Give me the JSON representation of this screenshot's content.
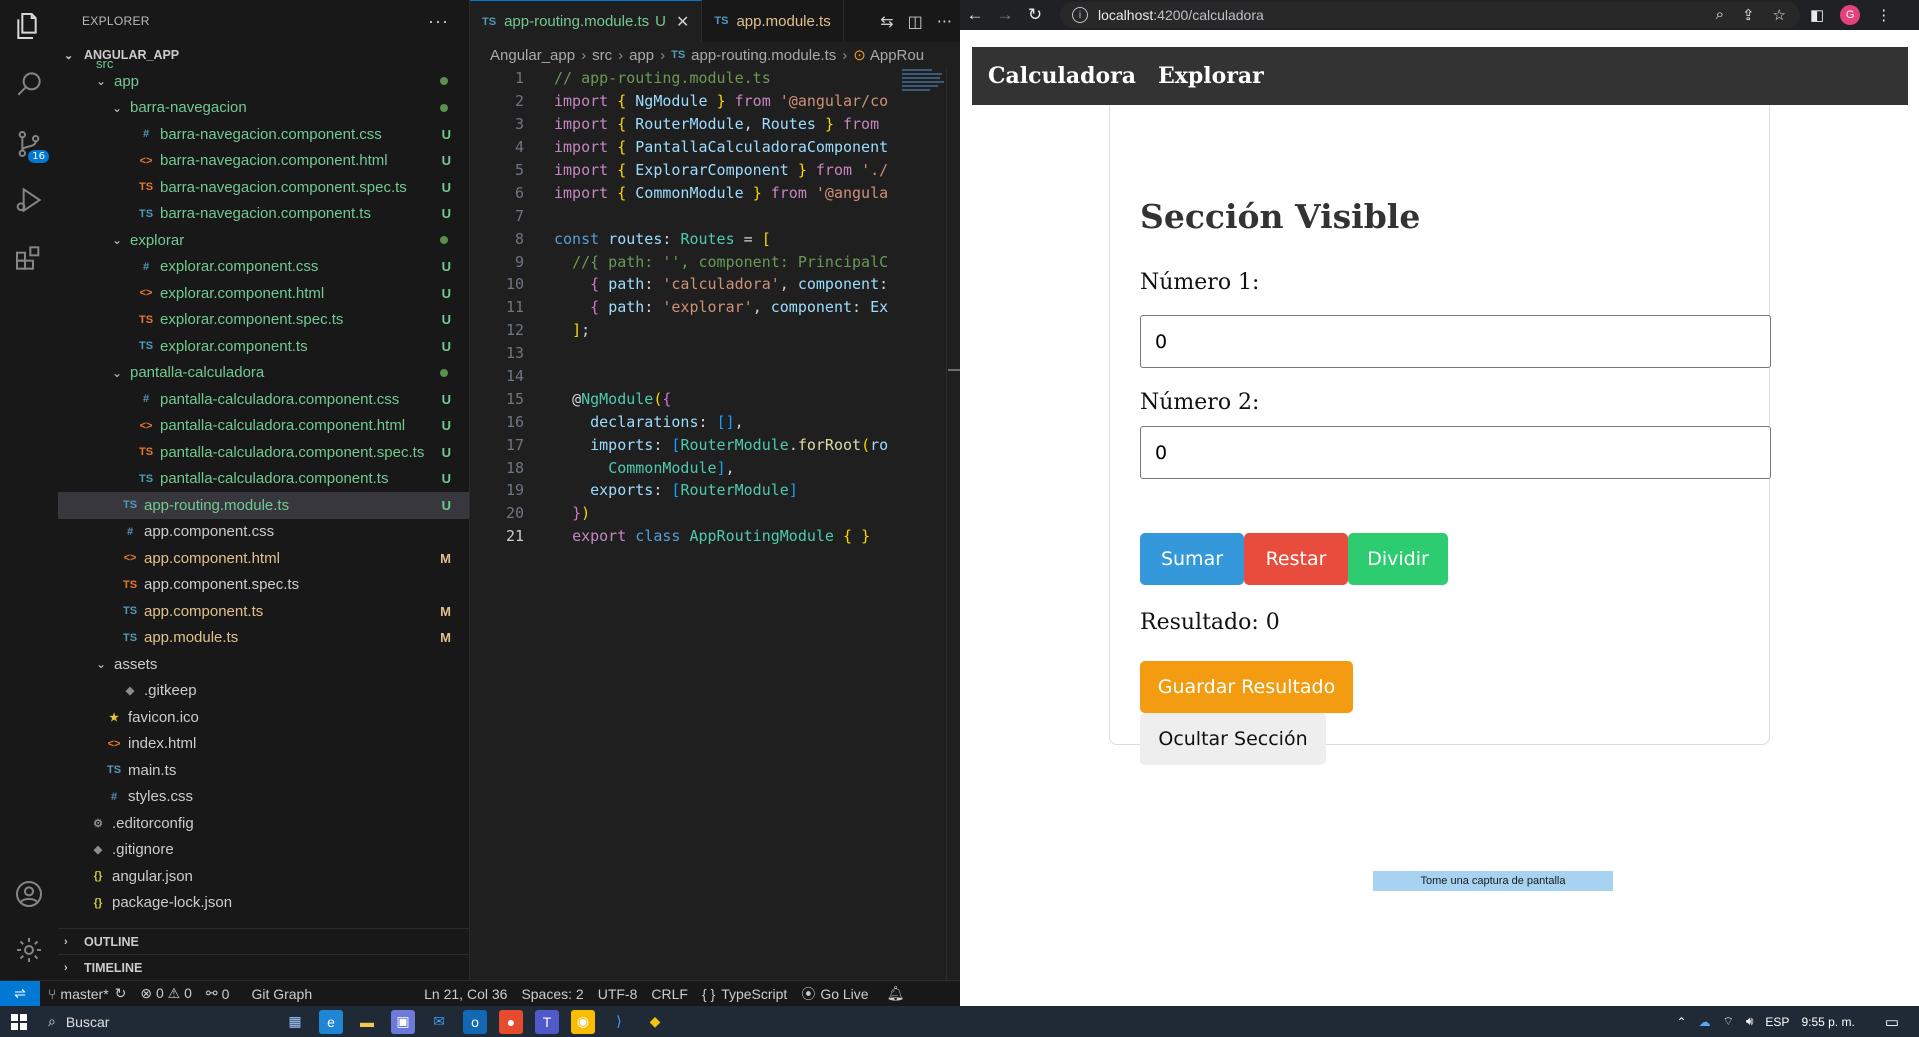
{
  "vscode": {
    "activity_bar": {
      "items": [
        {
          "name": "explorer-icon",
          "active": true
        },
        {
          "name": "search-icon"
        },
        {
          "name": "source-control-icon",
          "badge": "16"
        },
        {
          "name": "run-debug-icon"
        },
        {
          "name": "extensions-icon"
        }
      ],
      "bottom": [
        {
          "name": "accounts-icon"
        },
        {
          "name": "manage-gear-icon"
        }
      ]
    },
    "explorer": {
      "header": "EXPLORER",
      "more_actions": "···",
      "root_label": "ANGULAR_APP",
      "src_label": "src",
      "tree": [
        {
          "label": "app",
          "type": "folder",
          "depth": 1,
          "status": "dot",
          "color": "green"
        },
        {
          "label": "barra-navegacion",
          "type": "folder",
          "depth": 2,
          "status": "dot",
          "color": "green"
        },
        {
          "label": "barra-navegacion.component.css",
          "type": "css",
          "depth": 3,
          "status": "U",
          "color": "green"
        },
        {
          "label": "barra-navegacion.component.html",
          "type": "html",
          "depth": 3,
          "status": "U",
          "color": "green"
        },
        {
          "label": "barra-navegacion.component.spec.ts",
          "type": "spec",
          "depth": 3,
          "status": "U",
          "color": "green"
        },
        {
          "label": "barra-navegacion.component.ts",
          "type": "ts",
          "depth": 3,
          "status": "U",
          "color": "green"
        },
        {
          "label": "explorar",
          "type": "folder",
          "depth": 2,
          "status": "dot",
          "color": "green"
        },
        {
          "label": "explorar.component.css",
          "type": "css",
          "depth": 3,
          "status": "U",
          "color": "green"
        },
        {
          "label": "explorar.component.html",
          "type": "html",
          "depth": 3,
          "status": "U",
          "color": "green"
        },
        {
          "label": "explorar.component.spec.ts",
          "type": "spec",
          "depth": 3,
          "status": "U",
          "color": "green"
        },
        {
          "label": "explorar.component.ts",
          "type": "ts",
          "depth": 3,
          "status": "U",
          "color": "green"
        },
        {
          "label": "pantalla-calculadora",
          "type": "folder",
          "depth": 2,
          "status": "dot",
          "color": "green"
        },
        {
          "label": "pantalla-calculadora.component.css",
          "type": "css",
          "depth": 3,
          "status": "U",
          "color": "green"
        },
        {
          "label": "pantalla-calculadora.component.html",
          "type": "html",
          "depth": 3,
          "status": "U",
          "color": "green"
        },
        {
          "label": "pantalla-calculadora.component.spec.ts",
          "type": "spec",
          "depth": 3,
          "status": "U",
          "color": "green"
        },
        {
          "label": "pantalla-calculadora.component.ts",
          "type": "ts",
          "depth": 3,
          "status": "U",
          "color": "green"
        },
        {
          "label": "app-routing.module.ts",
          "type": "ts",
          "depth": 2,
          "status": "U",
          "color": "green",
          "selected": true
        },
        {
          "label": "app.component.css",
          "type": "css",
          "depth": 2,
          "status": "",
          "color": "white"
        },
        {
          "label": "app.component.html",
          "type": "html",
          "depth": 2,
          "status": "M",
          "color": "mod"
        },
        {
          "label": "app.component.spec.ts",
          "type": "spec",
          "depth": 2,
          "status": "",
          "color": "white"
        },
        {
          "label": "app.component.ts",
          "type": "ts",
          "depth": 2,
          "status": "M",
          "color": "mod"
        },
        {
          "label": "app.module.ts",
          "type": "ts",
          "depth": 2,
          "status": "M",
          "color": "mod"
        },
        {
          "label": "assets",
          "type": "folder",
          "depth": 1,
          "status": "",
          "color": "white"
        },
        {
          "label": ".gitkeep",
          "type": "git",
          "depth": 2,
          "status": "",
          "color": "white"
        },
        {
          "label": "favicon.ico",
          "type": "star",
          "depth": 1,
          "status": "",
          "color": "white"
        },
        {
          "label": "index.html",
          "type": "html",
          "depth": 1,
          "status": "",
          "color": "white"
        },
        {
          "label": "main.ts",
          "type": "ts",
          "depth": 1,
          "status": "",
          "color": "white"
        },
        {
          "label": "styles.css",
          "type": "css",
          "depth": 1,
          "status": "",
          "color": "white"
        },
        {
          "label": ".editorconfig",
          "type": "gear",
          "depth": 0,
          "status": "",
          "color": "white"
        },
        {
          "label": ".gitignore",
          "type": "git",
          "depth": 0,
          "status": "",
          "color": "white"
        },
        {
          "label": "angular.json",
          "type": "json",
          "depth": 0,
          "status": "",
          "color": "white"
        },
        {
          "label": "package-lock.json",
          "type": "json",
          "depth": 0,
          "status": "",
          "color": "white"
        }
      ],
      "outline_label": "OUTLINE",
      "timeline_label": "TIMELINE"
    },
    "tabs": [
      {
        "ts_icon": "TS",
        "label": "app-routing.module.ts",
        "mark": "U",
        "active": true
      },
      {
        "ts_icon": "TS",
        "label": "app.module.ts",
        "mark": "",
        "active": false
      }
    ],
    "breadcrumb": {
      "parts": [
        "Angular_app",
        "src",
        "app"
      ],
      "file_icon": "TS",
      "file": "app-routing.module.ts",
      "symbol": "AppRou"
    },
    "code_lines": [
      "1",
      "2",
      "3",
      "4",
      "5",
      "6",
      "7",
      "8",
      "9",
      "10",
      "11",
      "12",
      "13",
      "14",
      "15",
      "16",
      "17",
      "18",
      "19",
      "20",
      "21"
    ],
    "status_bar": {
      "branch": "master*",
      "problems": "⊗ 0 ⚠ 0",
      "ports": "0",
      "git_graph": "Git Graph",
      "position": "Ln 21, Col 36",
      "spaces": "Spaces: 2",
      "encoding": "UTF-8",
      "eol": "CRLF",
      "language": "TypeScript",
      "go_live": "Go Live"
    }
  },
  "browser": {
    "url_host": "localhost",
    "url_rest": ":4200/calculadora",
    "profile_initial": "G",
    "app": {
      "nav": [
        "Calculadora",
        "Explorar"
      ],
      "title": "Sección Visible",
      "label1": "Número 1:",
      "input1_value": "0",
      "label2": "Número 2:",
      "input2_value": "0",
      "btn_sumar": "Sumar",
      "btn_restar": "Restar",
      "btn_dividir": "Dividir",
      "resultado": "Resultado: 0",
      "btn_guardar": "Guardar Resultado",
      "btn_ocultar": "Ocultar Sección"
    },
    "screenshot_hint": "Tome una captura de pantalla"
  },
  "taskbar": {
    "search": "Buscar",
    "lang": "ESP",
    "time": "9:55 p. m."
  },
  "colors": {
    "accent": "#0078d4",
    "sumar": "#3498db",
    "restar": "#e74c3c",
    "dividir": "#2ecc71",
    "guardar": "#f39c12"
  }
}
